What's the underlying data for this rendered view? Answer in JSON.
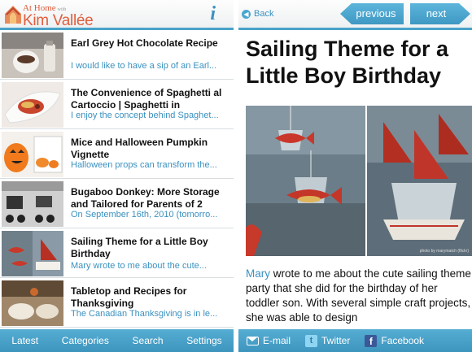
{
  "left": {
    "logo_top": "At Home",
    "logo_with": "with",
    "logo_name": "Kim Vallée",
    "info_icon": "i",
    "articles": [
      {
        "title": "Earl Grey Hot Chocolate Recipe",
        "snippet": "I would like to have a sip of an Earl..."
      },
      {
        "title": "The Convenience of Spaghetti al Cartoccio | Spaghetti in",
        "snippet": "I enjoy the concept behind Spaghet..."
      },
      {
        "title": "Mice and Halloween Pumpkin Vignette",
        "snippet": "Halloween props can transform the..."
      },
      {
        "title": "Bugaboo Donkey: More Storage and Tailored for Parents of 2",
        "snippet": "On September 16th, 2010 (tomorro..."
      },
      {
        "title": "Sailing Theme for a Little Boy Birthday",
        "snippet": "Mary wrote to me about the cute..."
      },
      {
        "title": "Tabletop and Recipes for Thanksgiving",
        "snippet": "The Canadian Thanksgiving is in le..."
      }
    ],
    "tabs": [
      "Latest",
      "Categories",
      "Search",
      "Settings"
    ]
  },
  "right": {
    "back_label": "Back",
    "prev_label": "previous",
    "next_label": "next",
    "post_title": "Sailing Theme for a Little Boy Birthday",
    "photo_credit": "photo by marymatch (flickr)",
    "body_link": "Mary",
    "body_text": " wrote to me about the cute sailing theme party that she did for the birthday of her toddler son. With several simple craft projects, she was able to design",
    "share": {
      "email": "E-mail",
      "twitter": "Twitter",
      "facebook": "Facebook"
    }
  },
  "colors": {
    "accent": "#3b91c0",
    "bar": "#4aa3c9",
    "logo": "#e25d3d"
  }
}
